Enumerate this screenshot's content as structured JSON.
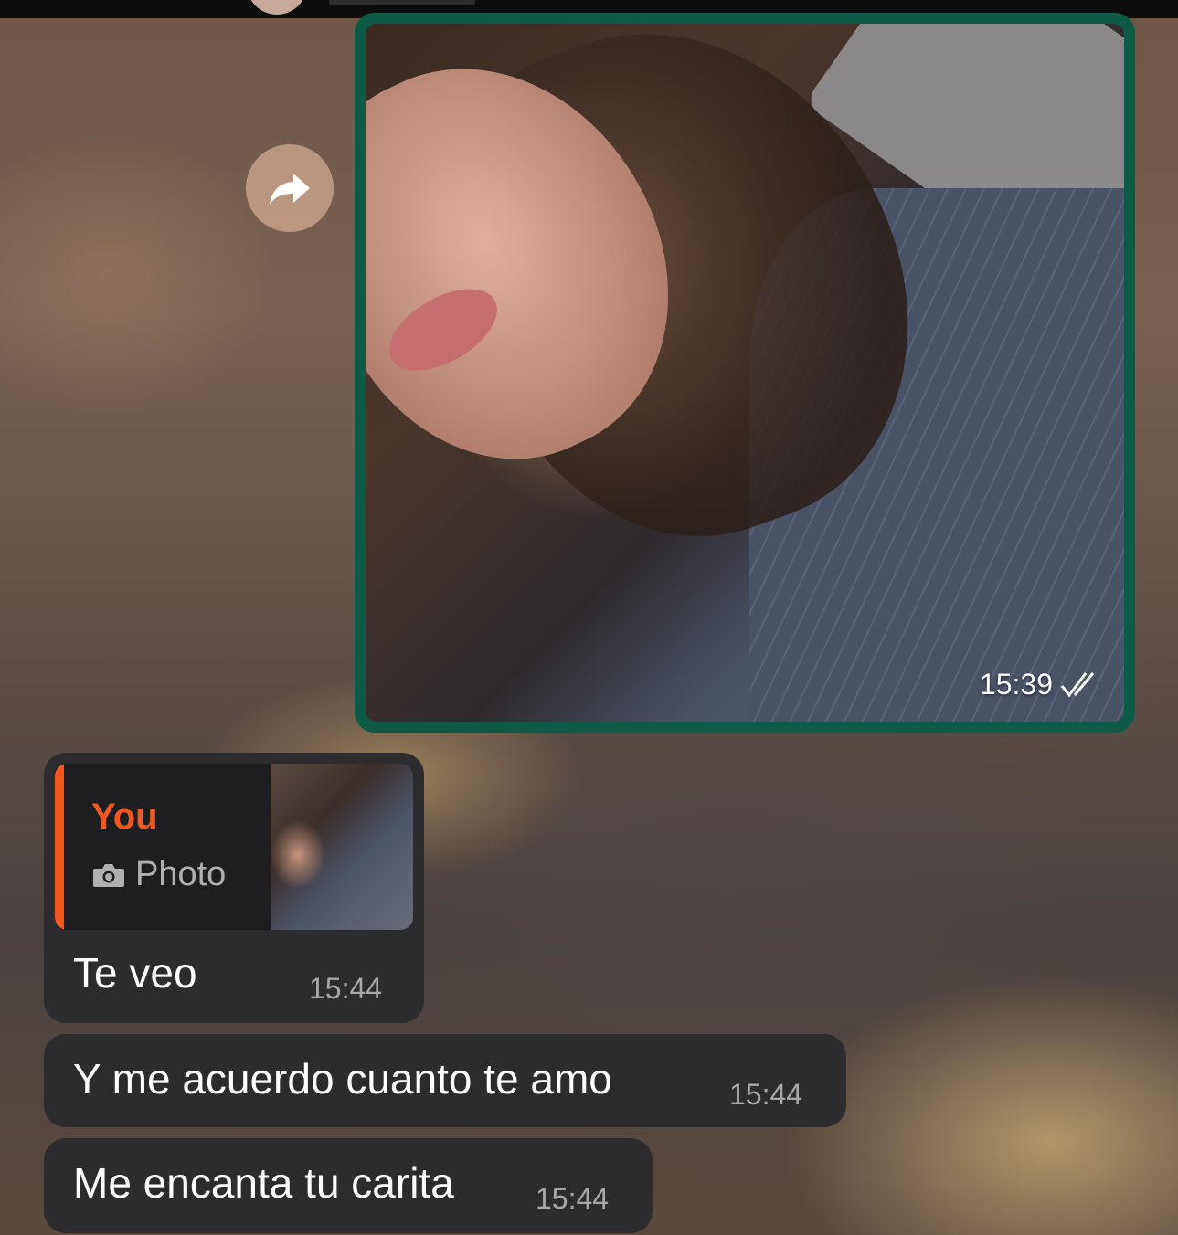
{
  "photo_message": {
    "time": "15:39",
    "status_icon": "double-check-icon"
  },
  "messages": [
    {
      "quote_author": "You",
      "quote_kind": "Photo",
      "text": "Te veo",
      "time": "15:44"
    },
    {
      "text": "Y me acuerdo cuanto te amo",
      "time": "15:44"
    },
    {
      "text": "Me encanta tu carita",
      "time": "15:44"
    }
  ],
  "colors": {
    "outgoing_bubble": "#0e5a46",
    "incoming_bubble": "#2c2c2e",
    "quote_accent": "#f2571e"
  }
}
